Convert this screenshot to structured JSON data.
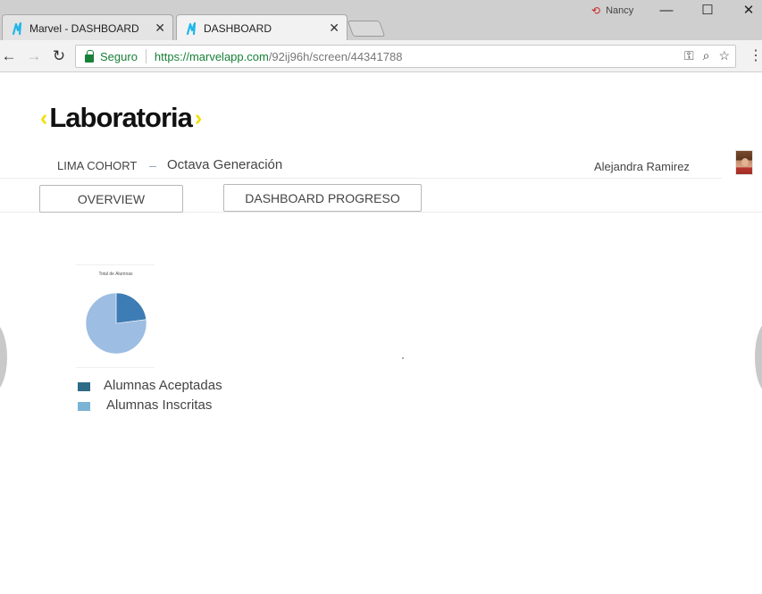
{
  "browser": {
    "tabs": [
      {
        "title": "Marvel - DASHBOARD",
        "active": false
      },
      {
        "title": "DASHBOARD",
        "active": true
      }
    ],
    "profile_name": "Nancy",
    "address": {
      "secure_label": "Seguro",
      "url_host": "https://marvelapp.com",
      "url_path": "/92ij96h/screen/44341788"
    },
    "icons": {
      "back": "back-arrow-icon",
      "forward": "forward-arrow-icon",
      "reload": "reload-icon",
      "key": "key-icon",
      "zoom": "zoom-icon",
      "bookmark": "star-icon",
      "menu": "menu-dots-icon"
    }
  },
  "page": {
    "logo": {
      "text": "Laboratoria",
      "accent_color": "#f1e000"
    },
    "cohort": "LIMA COHORT",
    "generation": "Octava Generación",
    "user_name": "Alejandra Ramirez",
    "tabs": [
      {
        "label": "OVERVIEW"
      },
      {
        "label": "DASHBOARD PROGRESO"
      }
    ]
  },
  "chart_data": {
    "type": "pie",
    "title": "Total de Alumnas",
    "slices": [
      {
        "label": "Alumnas Aceptadas",
        "value": 23,
        "color": "#3d7cb4"
      },
      {
        "label": "Alumnas Inscritas",
        "value": 77,
        "color": "#9dbde2"
      }
    ],
    "legend_position": "bottom",
    "legend": [
      {
        "label": "Alumnas Aceptadas",
        "color": "#2e6b87"
      },
      {
        "label": "Alumnas Inscritas",
        "color": "#7bb3d6"
      }
    ]
  }
}
